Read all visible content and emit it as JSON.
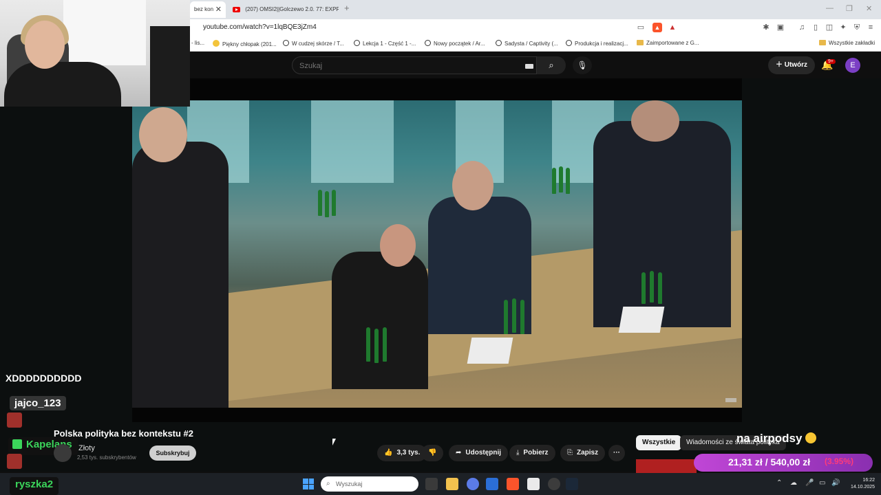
{
  "browser": {
    "tabs": [
      {
        "label": "bez kon",
        "active": true
      },
      {
        "label": "(207) OMSI2||Golczewo 2.0. 77: EXPR",
        "active": false
      }
    ],
    "url": "youtube.com/watch?v=1lqBQE3jZm4"
  },
  "bookmarks": [
    "- lis...",
    "Piękny chłopak (201...",
    "W cudzej skórze / T...",
    "Lekcja 1 - Część 1 -...",
    "Nowy początek / Ar...",
    "Sadysta / Captivity (...",
    "Produkcja i realizacj...",
    "Zaimportowane z G...",
    "Wszystkie zakładki"
  ],
  "youtube": {
    "search_placeholder": "Szukaj",
    "create_label": "Utwórz",
    "notifications_badge": "9+",
    "avatar_letter": "E"
  },
  "video": {
    "title": "Polska polityka bez kontekstu #2",
    "channel": "Złoty",
    "subscribers": "2,53 tys. subskrybentów",
    "subscribe_label": "Subskrybuj",
    "likes": "3,3 tys.",
    "share_label": "Udostępnij",
    "download_label": "Pobierz",
    "save_label": "Zapisz",
    "more_label": "···"
  },
  "chips": [
    {
      "label": "Wszystkie",
      "selected": true
    },
    {
      "label": "Wiadomości ze świata polityka",
      "selected": false
    }
  ],
  "overlay": {
    "chat_message": "XDDDDDDDDDD",
    "chat_users": [
      "jajco_123",
      "Kapelans",
      "ryszka2"
    ],
    "airpods_text": "na airpodsy",
    "goal_amount": "21,31 zł / 540,00 zł",
    "goal_percent": "(3.95%)",
    "goal_progress": 0.0395
  },
  "taskbar": {
    "search_placeholder": "Wyszukaj",
    "time": "16:22",
    "date": "14.10.2025"
  }
}
